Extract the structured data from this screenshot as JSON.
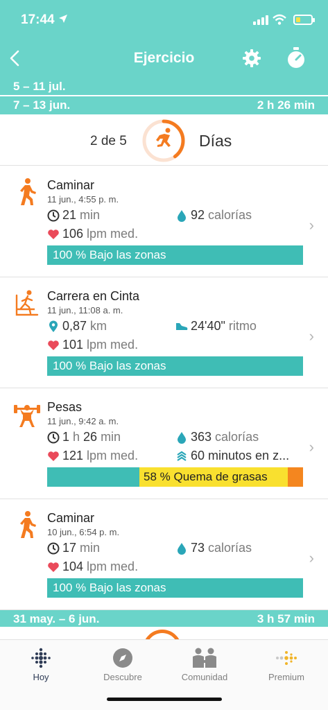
{
  "status": {
    "time": "17:44"
  },
  "nav": {
    "title": "Ejercicio"
  },
  "weeks": [
    {
      "range": "5 – 11 jul.",
      "duration": ""
    },
    {
      "range": "7 – 13 jun.",
      "duration": "2 h 26 min"
    },
    {
      "range": "31 may. – 6 jun.",
      "duration": "3 h 57 min"
    }
  ],
  "summary": {
    "count": "2 de 5",
    "label": "Días",
    "progress": 0.4
  },
  "activities": [
    {
      "name": "Caminar",
      "date": "11 jun., 4:55 p. m.",
      "icon": "walking-icon",
      "stat1": {
        "icon": "clock-icon",
        "parts": [
          {
            "value": "21",
            "unit": "min"
          }
        ]
      },
      "stat2": {
        "icon": "calories-drop-icon",
        "value": "92",
        "unit": "calorías"
      },
      "stat3": {
        "icon": "heart-icon",
        "value": "106",
        "unit": "lpm med."
      },
      "zone": {
        "label": "100 % Bajo las zonas"
      }
    },
    {
      "name": "Carrera en Cinta",
      "date": "11 jun., 11:08 a. m.",
      "icon": "treadmill-icon",
      "stat1": {
        "icon": "location-pin-icon",
        "parts": [
          {
            "value": "0,87",
            "unit": "km"
          }
        ]
      },
      "stat2": {
        "icon": "shoe-icon",
        "value": "24'40\"",
        "unit": "ritmo"
      },
      "stat3": {
        "icon": "heart-icon",
        "value": "101",
        "unit": "lpm med."
      },
      "zone": {
        "label": "100 % Bajo las zonas"
      }
    },
    {
      "name": "Pesas",
      "date": "11 jun., 9:42 a. m.",
      "icon": "weightlifting-icon",
      "stat1": {
        "icon": "clock-icon",
        "parts": [
          {
            "value": "1",
            "unit": "h"
          },
          {
            "value": "26",
            "unit": "min"
          }
        ]
      },
      "stat2": {
        "icon": "calories-drop-icon",
        "value": "363",
        "unit": "calorías"
      },
      "stat3": {
        "icon": "heart-icon",
        "value": "121",
        "unit": "lpm med."
      },
      "stat4": {
        "icon": "zone-minutes-icon",
        "text": "60 minutos en z..."
      },
      "zone": {
        "below_fraction": 0.36,
        "fatburn_label": "58 % Quema de grasas",
        "fatburn_fraction": 0.58,
        "cardio_fraction": 0.06
      }
    },
    {
      "name": "Caminar",
      "date": "10 jun., 6:54 p. m.",
      "icon": "walking-icon",
      "stat1": {
        "icon": "clock-icon",
        "parts": [
          {
            "value": "17",
            "unit": "min"
          }
        ]
      },
      "stat2": {
        "icon": "calories-drop-icon",
        "value": "73",
        "unit": "calorías"
      },
      "stat3": {
        "icon": "heart-icon",
        "value": "104",
        "unit": "lpm med."
      },
      "zone": {
        "label": "100 % Bajo las zonas"
      }
    }
  ],
  "tabs": [
    {
      "label": "Hoy",
      "icon": "today-dots-icon",
      "active": true
    },
    {
      "label": "Descubre",
      "icon": "compass-icon"
    },
    {
      "label": "Comunidad",
      "icon": "community-icon"
    },
    {
      "label": "Premium",
      "icon": "premium-dots-icon"
    }
  ],
  "colors": {
    "teal": "#6ad4c9",
    "zone_teal": "#3fbdb5",
    "orange": "#f47b20",
    "fatburn_yellow": "#f9e02f",
    "heart": "#ea4a5a"
  }
}
